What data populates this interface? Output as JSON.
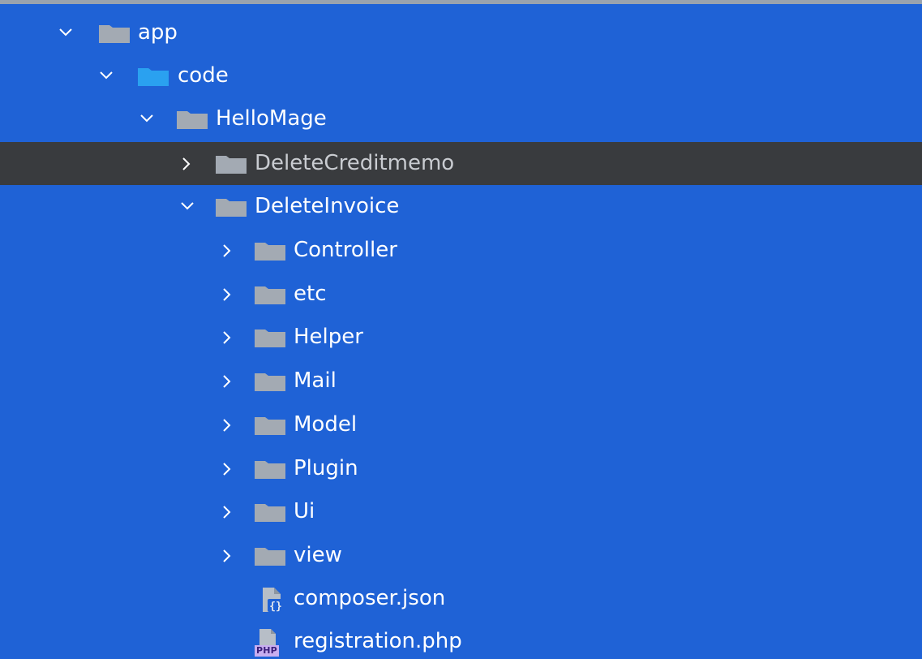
{
  "tree": {
    "items": [
      {
        "label": "app",
        "expanded": true
      },
      {
        "label": "code",
        "expanded": true
      },
      {
        "label": "HelloMage",
        "expanded": true
      },
      {
        "label": "DeleteCreditmemo",
        "expanded": false,
        "selected": true
      },
      {
        "label": "DeleteInvoice",
        "expanded": true
      },
      {
        "label": "Controller",
        "expanded": false
      },
      {
        "label": "etc",
        "expanded": false
      },
      {
        "label": "Helper",
        "expanded": false
      },
      {
        "label": "Mail",
        "expanded": false
      },
      {
        "label": "Model",
        "expanded": false
      },
      {
        "label": "Plugin",
        "expanded": false
      },
      {
        "label": "Ui",
        "expanded": false
      },
      {
        "label": "view",
        "expanded": false
      },
      {
        "label": "composer.json",
        "icon": "json-file-icon"
      },
      {
        "label": "registration.php",
        "icon": "php-file-icon",
        "badge": "PHP"
      }
    ]
  },
  "colors": {
    "background": "#1f62d6",
    "highlight_row": "#393b3e",
    "folder_gray": "#a3aab3",
    "folder_source": "#2aa1f0",
    "text": "#ffffff"
  }
}
